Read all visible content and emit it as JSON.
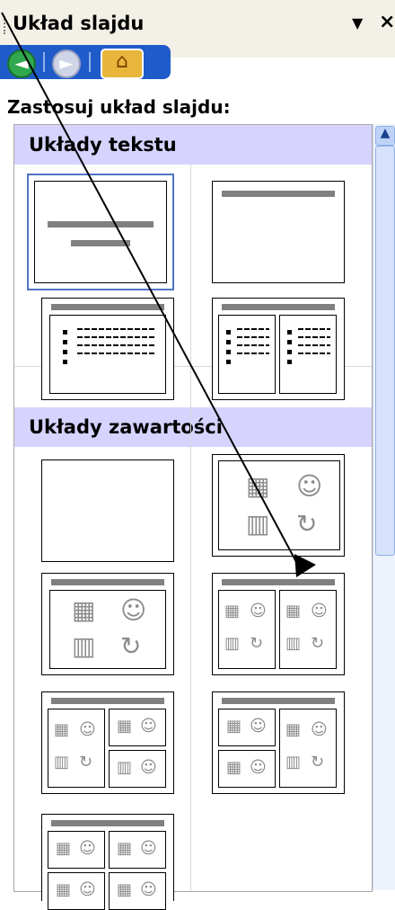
{
  "pane": {
    "title": "Układ slajdu",
    "dropdown_glyph": "▼",
    "close_glyph": "×",
    "apply_label": "Zastosuj układ slajdu:"
  },
  "nav": {
    "back_glyph": "◄",
    "forward_glyph": "►",
    "home_glyph": "⌂",
    "back_icon": "back-arrow-icon",
    "forward_icon": "forward-arrow-icon",
    "home_icon": "home-icon"
  },
  "sections": {
    "text_layouts": "Układy tekstu",
    "content_layouts": "Układy zawartości"
  },
  "content_icons": {
    "table_glyph": "▦",
    "person_glyph": "☺",
    "chart_glyph": "▥",
    "org_glyph": "↻"
  },
  "colors": {
    "title_bar": "#f3f1e7",
    "section_band": "#d6d3ff",
    "selection": "#5073c8",
    "nav_bar": "#1f5cc9"
  }
}
